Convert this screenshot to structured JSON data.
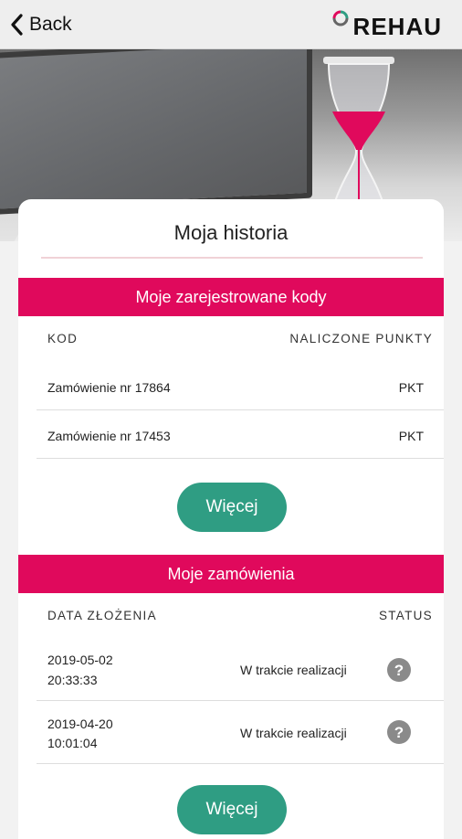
{
  "header": {
    "back_label": "Back",
    "brand": "REHAU",
    "colors": {
      "brand_red": "#e0095c",
      "button_green": "#2f9d83"
    }
  },
  "card": {
    "title": "Moja historia"
  },
  "codes": {
    "section_title": "Moje zarejestrowane kody",
    "columns": {
      "code": "KOD",
      "points": "NALICZONE PUNKTY"
    },
    "rows": [
      {
        "code": "Zamówienie nr 17864",
        "points": "PKT"
      },
      {
        "code": "Zamówienie nr 17453",
        "points": "PKT"
      }
    ],
    "more_label": "Więcej"
  },
  "orders": {
    "section_title": "Moje zamówienia",
    "columns": {
      "date": "DATA ZŁOŻENIA",
      "status": "STATUS"
    },
    "rows": [
      {
        "date": "2019-05-02",
        "time": "20:33:33",
        "status": "W trakcie realizacji",
        "icon": "question-icon"
      },
      {
        "date": "2019-04-20",
        "time": "10:01:04",
        "status": "W trakcie realizacji",
        "icon": "question-icon"
      }
    ],
    "more_label": "Więcej"
  }
}
